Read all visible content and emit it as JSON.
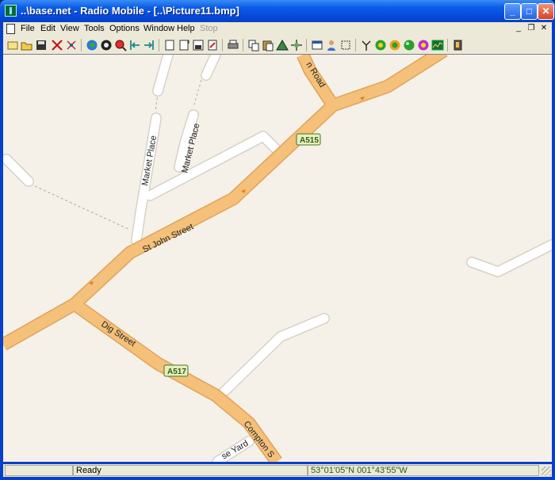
{
  "window": {
    "title": "..\\base.net - Radio Mobile - [..\\Picture11.bmp]",
    "minimize_icon": "minimize-icon",
    "maximize_icon": "maximize-icon",
    "close_icon": "close-icon"
  },
  "menu": {
    "items": [
      "File",
      "Edit",
      "View",
      "Tools",
      "Options",
      "Window",
      "Help",
      "Stop"
    ],
    "disabled": [
      "Stop"
    ]
  },
  "toolbar": {
    "icons": [
      "new-icon",
      "open-icon",
      "save-icon",
      "cut-network-icon",
      "network-properties-icon",
      "globe-icon",
      "map-properties-icon",
      "zoom-icon",
      "first-icon",
      "last-icon",
      "picture-icon",
      "export-icon",
      "save-picture-icon",
      "pdf-icon",
      "print-icon",
      "copy-icon",
      "paste-icon",
      "merge-icon",
      "extract-icon",
      "window-icon",
      "units-icon",
      "select-icon",
      "antenna-icon",
      "radio-link-icon",
      "coverage-icon",
      "rainbow-icon",
      "chart-icon",
      "exit-icon"
    ]
  },
  "map": {
    "roads": {
      "st_john_street": "St John Street",
      "dig_street": "Dig Street",
      "market_place_1": "Market Place",
      "market_place_2": "Market Place",
      "road_top": "n Road",
      "compton": "Compton S",
      "yard": "se Yard"
    },
    "shields": {
      "a515": "A515",
      "a517": "A517"
    },
    "colors": {
      "background": "#f5f1e9",
      "main_road": "#f4c07a",
      "main_road_casing": "#e0a35a",
      "minor_road": "#ffffff",
      "minor_casing": "#d6d2c8",
      "shield_green": "#3f7a1f"
    }
  },
  "status": {
    "left": "",
    "message": "Ready",
    "coordinates": "53°01'05\"N 001°43'55\"W"
  }
}
